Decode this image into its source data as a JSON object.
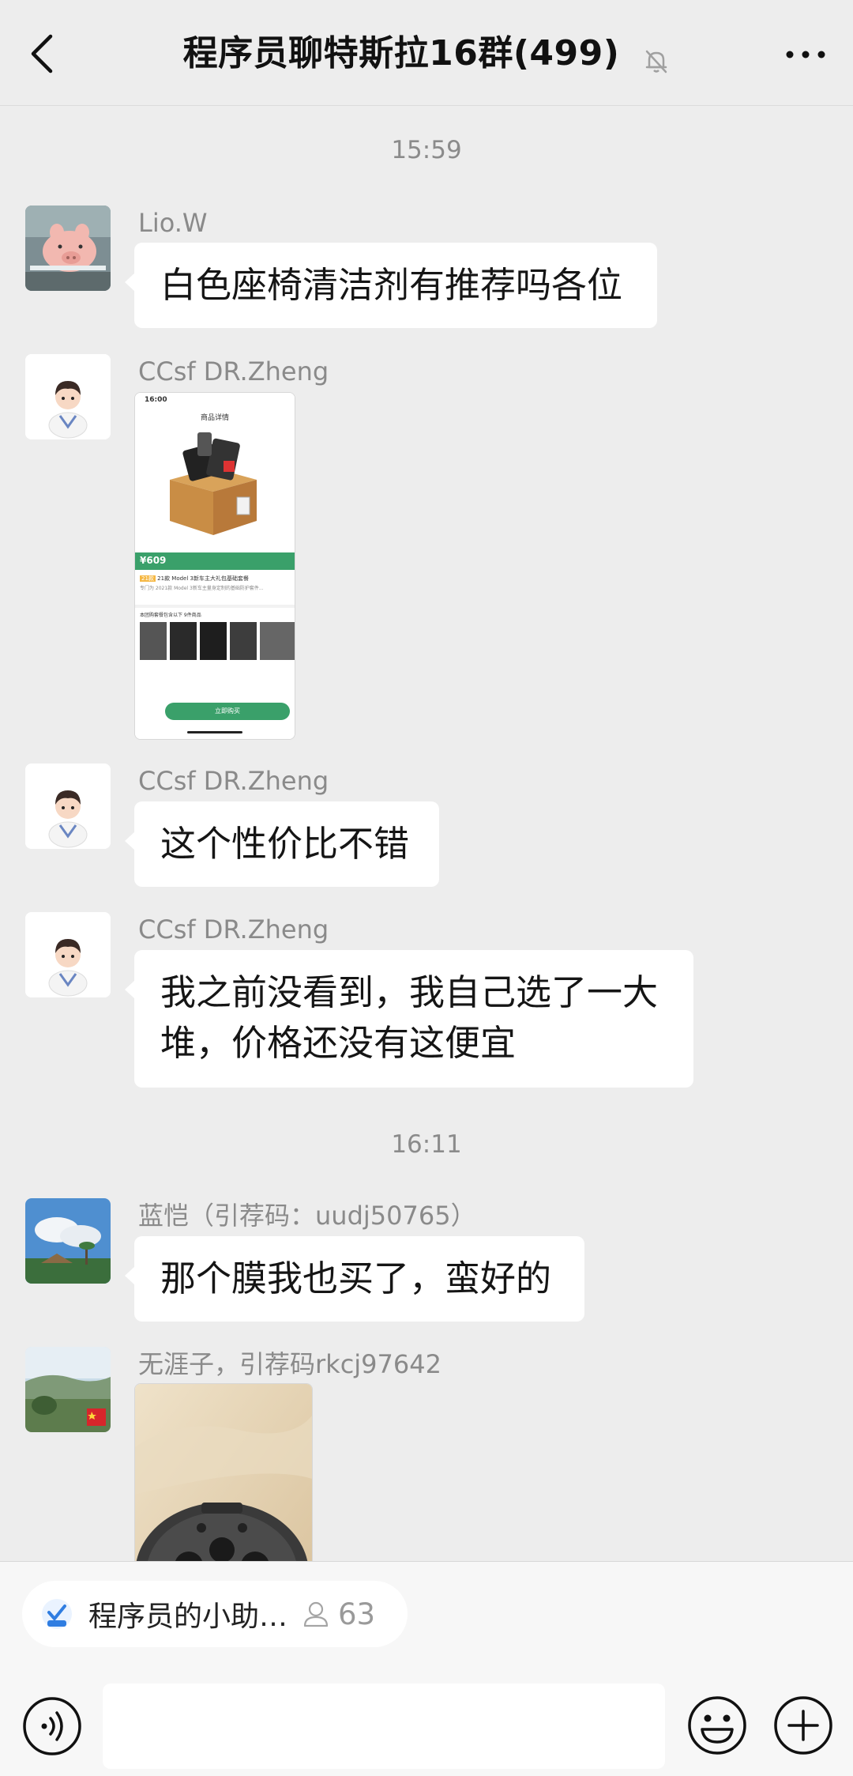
{
  "header": {
    "title": "程序员聊特斯拉16群(499)"
  },
  "messages": {
    "time1": "15:59",
    "m1": {
      "sender": "Lio.W",
      "text": "白色座椅清洁剂有推荐吗各位"
    },
    "m2": {
      "sender": "CCsf DR.Zheng",
      "image": {
        "status_time": "16:00",
        "page_title": "商品详情",
        "price": "¥609",
        "badge": "21款",
        "product_title": "21款 Model 3新车主大礼包基础套餐",
        "product_desc": "专门为 2021款 Model 3新车主量身定制的基础防护套件...",
        "section": "本团购套餐包含以下 9件商品",
        "buy_label": "立即购买"
      }
    },
    "m3": {
      "sender": "CCsf DR.Zheng",
      "text": "这个性价比不错"
    },
    "m4": {
      "sender": "CCsf DR.Zheng",
      "line1": "我之前没看到，我自己选了一大",
      "line2": "堆，价格还没有这便宜"
    },
    "time2": "16:11",
    "m5": {
      "sender": "蓝恺（引荐码：uudj50765）",
      "text": "那个膜我也买了，蛮好的"
    },
    "m6": {
      "sender": "无涯子，引荐码rkcj97642"
    }
  },
  "bottom": {
    "mini_program_label": "程序员的小助…",
    "member_count": "63"
  },
  "colors": {
    "background": "#ededed",
    "bubble": "#ffffff",
    "accent_green": "#3aa06a"
  }
}
